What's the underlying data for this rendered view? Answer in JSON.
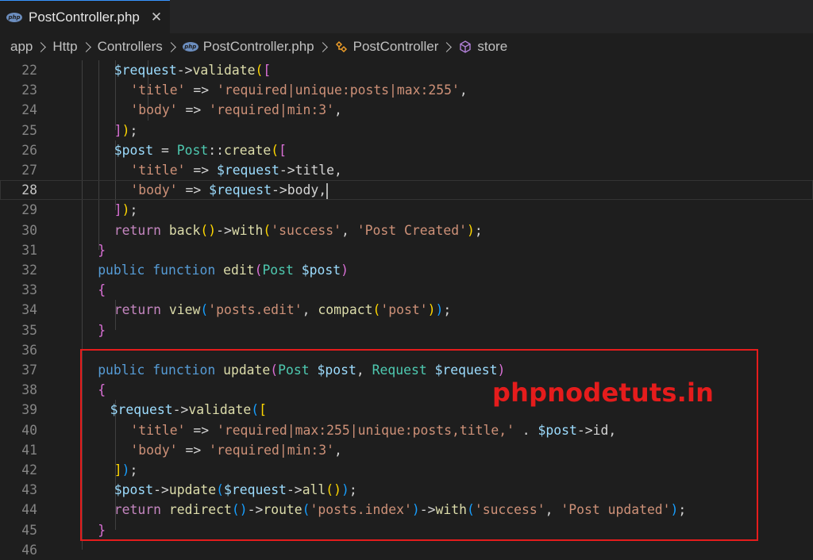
{
  "tab": {
    "title": "PostController.php",
    "close": "✕",
    "icon": "php"
  },
  "breadcrumb": [
    "app",
    "Http",
    "Controllers",
    "PostController.php",
    "PostController",
    "store"
  ],
  "watermark": "phpnodetuts.in",
  "colors": {
    "accent": "#3794ff",
    "highlight": "#e51c1c",
    "background": "#1e1e1e"
  },
  "code_lines": [
    {
      "n": "22",
      "indent": 3,
      "tokens": [
        [
          "var",
          "$request"
        ],
        [
          "op",
          "->"
        ],
        [
          "fn",
          "validate"
        ],
        [
          "b1",
          "("
        ],
        [
          "b2",
          "["
        ]
      ]
    },
    {
      "n": "23",
      "indent": 4,
      "tokens": [
        [
          "str",
          "'title'"
        ],
        [
          "op",
          " => "
        ],
        [
          "str",
          "'required|unique:posts|max:255'"
        ],
        [
          "op",
          ","
        ]
      ]
    },
    {
      "n": "24",
      "indent": 4,
      "tokens": [
        [
          "str",
          "'body'"
        ],
        [
          "op",
          " => "
        ],
        [
          "str",
          "'required|min:3'"
        ],
        [
          "op",
          ","
        ]
      ]
    },
    {
      "n": "25",
      "indent": 3,
      "tokens": [
        [
          "b2",
          "]"
        ],
        [
          "b1",
          ")"
        ],
        [
          "op",
          ";"
        ]
      ]
    },
    {
      "n": "26",
      "indent": 3,
      "tokens": [
        [
          "var",
          "$post"
        ],
        [
          "op",
          " = "
        ],
        [
          "cls",
          "Post"
        ],
        [
          "op",
          "::"
        ],
        [
          "fn",
          "create"
        ],
        [
          "b1",
          "("
        ],
        [
          "b2",
          "["
        ]
      ]
    },
    {
      "n": "27",
      "indent": 4,
      "tokens": [
        [
          "str",
          "'title'"
        ],
        [
          "op",
          " => "
        ],
        [
          "var",
          "$request"
        ],
        [
          "op",
          "->title,"
        ]
      ]
    },
    {
      "n": "28",
      "indent": 4,
      "tokens": [
        [
          "str",
          "'body'"
        ],
        [
          "op",
          " => "
        ],
        [
          "var",
          "$request"
        ],
        [
          "op",
          "->body,"
        ],
        [
          "cursor",
          ""
        ]
      ]
    },
    {
      "n": "29",
      "indent": 3,
      "tokens": [
        [
          "b2",
          "]"
        ],
        [
          "b1",
          ")"
        ],
        [
          "op",
          ";"
        ]
      ]
    },
    {
      "n": "30",
      "indent": 3,
      "tokens": [
        [
          "kw",
          "return "
        ],
        [
          "fn",
          "back"
        ],
        [
          "b1",
          "()"
        ],
        [
          "op",
          "->"
        ],
        [
          "fn",
          "with"
        ],
        [
          "b1",
          "("
        ],
        [
          "str",
          "'success'"
        ],
        [
          "op",
          ", "
        ],
        [
          "str",
          "'Post Created'"
        ],
        [
          "b1",
          ")"
        ],
        [
          "op",
          ";"
        ]
      ]
    },
    {
      "n": "31",
      "indent": 2,
      "tokens": [
        [
          "b2",
          "}"
        ]
      ]
    },
    {
      "n": "32",
      "indent": 2,
      "tokens": [
        [
          "sk",
          "public "
        ],
        [
          "sk",
          "function "
        ],
        [
          "fn",
          "edit"
        ],
        [
          "b2",
          "("
        ],
        [
          "cls",
          "Post "
        ],
        [
          "var",
          "$post"
        ],
        [
          "b2",
          ")"
        ]
      ]
    },
    {
      "n": "33",
      "indent": 2,
      "tokens": [
        [
          "b2",
          "{"
        ]
      ]
    },
    {
      "n": "34",
      "indent": 3,
      "tokens": [
        [
          "kw",
          "return "
        ],
        [
          "fn",
          "view"
        ],
        [
          "b3",
          "("
        ],
        [
          "str",
          "'posts.edit'"
        ],
        [
          "op",
          ", "
        ],
        [
          "fn",
          "compact"
        ],
        [
          "b1",
          "("
        ],
        [
          "str",
          "'post'"
        ],
        [
          "b1",
          ")"
        ],
        [
          "b3",
          ")"
        ],
        [
          "op",
          ";"
        ]
      ]
    },
    {
      "n": "35",
      "indent": 2,
      "tokens": [
        [
          "b2",
          "}"
        ]
      ]
    },
    {
      "n": "36",
      "indent": 0,
      "tokens": []
    },
    {
      "n": "37",
      "indent": 2,
      "tokens": [
        [
          "sk",
          "public "
        ],
        [
          "sk",
          "function "
        ],
        [
          "fn",
          "update"
        ],
        [
          "b2",
          "("
        ],
        [
          "cls",
          "Post "
        ],
        [
          "var",
          "$post"
        ],
        [
          "op",
          ", "
        ],
        [
          "cls",
          "Request "
        ],
        [
          "var",
          "$request"
        ],
        [
          "b2",
          ")"
        ]
      ]
    },
    {
      "n": "38",
      "indent": 2,
      "tokens": [
        [
          "b2",
          "{"
        ]
      ]
    },
    {
      "n": "39",
      "indent": 2.75,
      "tokens": [
        [
          "var",
          "$request"
        ],
        [
          "op",
          "->"
        ],
        [
          "fn",
          "validate"
        ],
        [
          "b3",
          "("
        ],
        [
          "b1",
          "["
        ]
      ]
    },
    {
      "n": "40",
      "indent": 4,
      "tokens": [
        [
          "str",
          "'title'"
        ],
        [
          "op",
          " => "
        ],
        [
          "str",
          "'required|max:255|unique:posts,title,'"
        ],
        [
          "op",
          " . "
        ],
        [
          "var",
          "$post"
        ],
        [
          "op",
          "->id,"
        ]
      ]
    },
    {
      "n": "41",
      "indent": 4,
      "tokens": [
        [
          "str",
          "'body'"
        ],
        [
          "op",
          " => "
        ],
        [
          "str",
          "'required|min:3'"
        ],
        [
          "op",
          ","
        ]
      ]
    },
    {
      "n": "42",
      "indent": 3,
      "tokens": [
        [
          "b1",
          "]"
        ],
        [
          "b3",
          ")"
        ],
        [
          "op",
          ";"
        ]
      ]
    },
    {
      "n": "43",
      "indent": 3,
      "tokens": [
        [
          "var",
          "$post"
        ],
        [
          "op",
          "->"
        ],
        [
          "fn",
          "update"
        ],
        [
          "b3",
          "("
        ],
        [
          "var",
          "$request"
        ],
        [
          "op",
          "->"
        ],
        [
          "fn",
          "all"
        ],
        [
          "b1",
          "()"
        ],
        [
          "b3",
          ")"
        ],
        [
          "op",
          ";"
        ]
      ]
    },
    {
      "n": "44",
      "indent": 3,
      "tokens": [
        [
          "kw",
          "return "
        ],
        [
          "fn",
          "redirect"
        ],
        [
          "b3",
          "()"
        ],
        [
          "op",
          "->"
        ],
        [
          "fn",
          "route"
        ],
        [
          "b3",
          "("
        ],
        [
          "str",
          "'posts.index'"
        ],
        [
          "b3",
          ")"
        ],
        [
          "op",
          "->"
        ],
        [
          "fn",
          "with"
        ],
        [
          "b3",
          "("
        ],
        [
          "str",
          "'success'"
        ],
        [
          "op",
          ", "
        ],
        [
          "str",
          "'Post updated'"
        ],
        [
          "b3",
          ")"
        ],
        [
          "op",
          ";"
        ]
      ]
    },
    {
      "n": "45",
      "indent": 2,
      "tokens": [
        [
          "b2",
          "}"
        ]
      ]
    },
    {
      "n": "46",
      "indent": 0,
      "tokens": []
    }
  ],
  "current_line": "28"
}
